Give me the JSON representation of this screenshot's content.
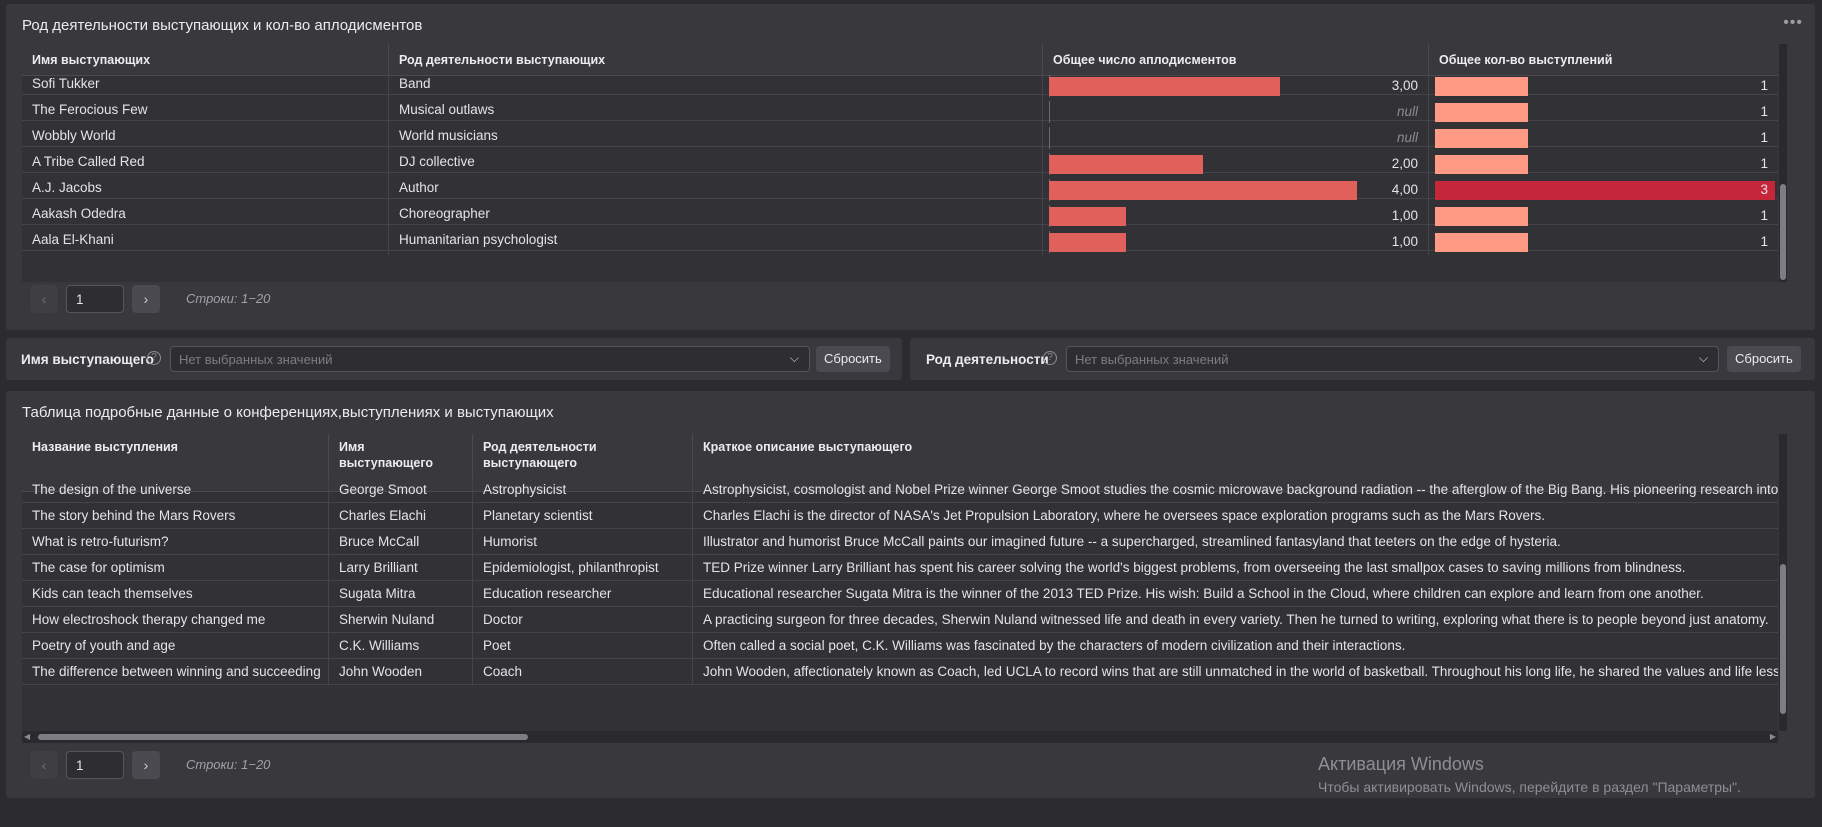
{
  "top_panel": {
    "title": "Род деятельности выступающих и кол-во аплодисментов",
    "more_icon": "ellipsis-icon",
    "columns": [
      "Имя выступающих",
      "Род деятельности выступающих",
      "Общее число аплодисментов",
      "Общее кол-во выступлений"
    ],
    "rows": [
      {
        "name": "Sofi Tukker",
        "occupation": "Band",
        "applause": "3,00",
        "applause_value": 3,
        "talks": "1",
        "talks_value": 1
      },
      {
        "name": "The Ferocious Few",
        "occupation": "Musical outlaws",
        "applause": "null",
        "applause_value": 0,
        "talks": "1",
        "talks_value": 1
      },
      {
        "name": "Wobbly World",
        "occupation": "World musicians",
        "applause": "null",
        "applause_value": 0,
        "talks": "1",
        "talks_value": 1
      },
      {
        "name": "A Tribe Called Red",
        "occupation": "DJ collective",
        "applause": "2,00",
        "applause_value": 2,
        "talks": "1",
        "talks_value": 1
      },
      {
        "name": "A.J. Jacobs",
        "occupation": "Author",
        "applause": "4,00",
        "applause_value": 4,
        "talks": "3",
        "talks_value": 3
      },
      {
        "name": "Aakash Odedra",
        "occupation": "Choreographer",
        "applause": "1,00",
        "applause_value": 1,
        "talks": "1",
        "talks_value": 1
      },
      {
        "name": "Aala El-Khani",
        "occupation": "Humanitarian psychologist",
        "applause": "1,00",
        "applause_value": 1,
        "talks": "1",
        "talks_value": 1
      }
    ],
    "pager": {
      "page": "1",
      "rows_info": "Строки: 1−20",
      "prev": "‹",
      "next": "›"
    }
  },
  "filters": {
    "speaker": {
      "label": "Имя выступающего",
      "help": "?",
      "placeholder": "Нет выбранных значений",
      "reset": "Сбросить"
    },
    "occupation": {
      "label": "Род деятельности",
      "help": "?",
      "placeholder": "Нет выбранных значений",
      "reset": "Сбросить"
    }
  },
  "bottom_panel": {
    "title": "Таблица подробные данные о конференциях,выступлениях и выступающих",
    "columns": [
      "Название выступления",
      "Имя выступающего",
      "Род деятельности выступающего",
      "Краткое описание выступающего"
    ],
    "rows": [
      {
        "talk": "The design of the universe",
        "speaker": "George Smoot",
        "occupation": "Astrophysicist",
        "description": "Astrophysicist, cosmologist and Nobel Prize winner George Smoot studies the cosmic microwave background radiation -- the afterglow of the Big Bang. His pioneering research into deep s"
      },
      {
        "talk": "The story behind the Mars Rovers",
        "speaker": "Charles Elachi",
        "occupation": "Planetary scientist",
        "description": "Charles Elachi is the director of NASA's Jet Propulsion Laboratory, where he oversees space exploration programs such as the Mars Rovers."
      },
      {
        "talk": "What is retro-futurism?",
        "speaker": "Bruce McCall",
        "occupation": "Humorist",
        "description": "Illustrator and humorist Bruce McCall paints our imagined future -- a supercharged, streamlined fantasyland that teeters on the edge of hysteria."
      },
      {
        "talk": "The case for optimism",
        "speaker": "Larry Brilliant",
        "occupation": "Epidemiologist, philanthropist",
        "description": "TED Prize winner Larry Brilliant has spent his career solving the world's biggest problems, from overseeing the last smallpox cases to saving millions from blindness."
      },
      {
        "talk": "Kids can teach themselves",
        "speaker": "Sugata Mitra",
        "occupation": "Education researcher",
        "description": "Educational researcher Sugata Mitra is the winner of the 2013 TED Prize. His wish: Build a School in the Cloud, where children can explore and learn from one another."
      },
      {
        "talk": "How electroshock therapy changed me",
        "speaker": "Sherwin Nuland",
        "occupation": "Doctor",
        "description": "A practicing surgeon for three decades, Sherwin Nuland witnessed life and death in every variety. Then he turned to writing, exploring what there is to people beyond just anatomy."
      },
      {
        "talk": "Poetry of youth and age",
        "speaker": "C.K. Williams",
        "occupation": "Poet",
        "description": "Often called a social poet, C.K. Williams was fascinated by the characters of modern civilization and their interactions."
      },
      {
        "talk": "The difference between winning and succeeding",
        "speaker": "John Wooden",
        "occupation": "Coach",
        "description": "John Wooden, affectionately known as Coach, led UCLA to record wins that are still unmatched in the world of basketball. Throughout his long life, he shared the values and life lessons he p"
      }
    ],
    "pager": {
      "page": "1",
      "rows_info": "Строки: 1−20",
      "prev": "‹",
      "next": "›"
    }
  },
  "watermark": {
    "line1": "Активация Windows",
    "line2": "Чтобы активировать Windows, перейдите в раздел \"Параметры\"."
  },
  "colors": {
    "applause_bar": "#e0615b",
    "talks_bar": "#ff9a85",
    "talks_bar_max": "#c5263a"
  }
}
